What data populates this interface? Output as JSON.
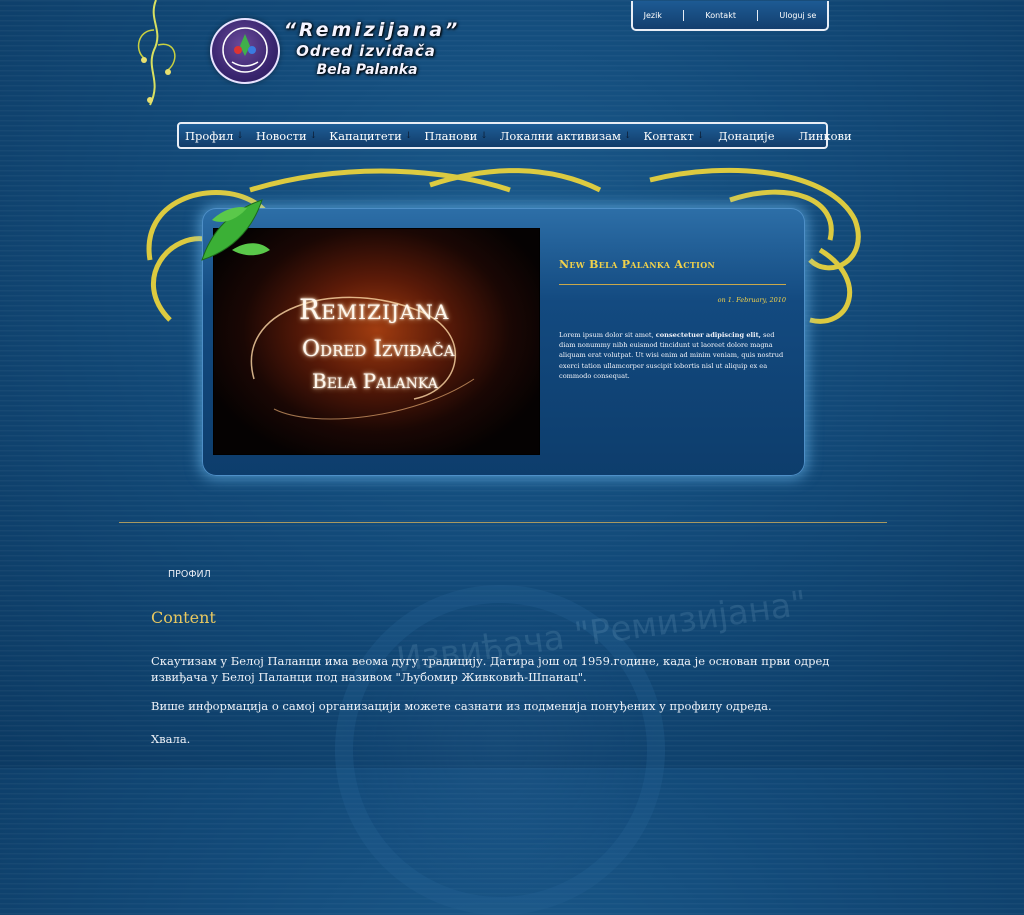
{
  "header": {
    "title_line1": "“Remizijana”",
    "title_line2": "Odred izviđača",
    "title_line3": "Bela Palanka"
  },
  "top_links": [
    "Jezik",
    "Kontakt",
    "Uloguj se"
  ],
  "nav": {
    "items": [
      {
        "label": "Профил",
        "arrow": "↓"
      },
      {
        "label": "Новости",
        "arrow": "↓"
      },
      {
        "label": "Капацитети",
        "arrow": "↓"
      },
      {
        "label": "Планови",
        "arrow": "↓"
      },
      {
        "label": "Локални активизам",
        "arrow": "↓"
      },
      {
        "label": "Контакт",
        "arrow": "↓"
      },
      {
        "label": "Донације",
        "arrow": ""
      },
      {
        "label": "Линкови",
        "arrow": ""
      }
    ]
  },
  "feature": {
    "image_lines": [
      "Remizijana",
      "Odred Izviđača",
      "Bela Palanka"
    ],
    "title": "New Bela Palanka Action",
    "date": "on 1. February, 2010",
    "text_lead": "Lorem ipsum dolor sit amet, ",
    "text_bold": "consectetuer adipiscing elit,",
    "text_rest": " sed diam nonummy nibh euismod tincidunt ut laoreet dolore magna aliquam erat volutpat. Ut wisi enim ad minim veniam, quis nostrud exerci tation ullamcorper suscipit lobortis nisl ut aliquip ex ea commodo consequat."
  },
  "content": {
    "breadcrumb": "ПРОФИЛ",
    "heading": "Content",
    "paragraphs": [
      "Скаутизам у Белој Паланци има веома дугу традицију. Датира још од 1959.године, када је основан први одред извиђача у Белој Паланци под називом \"Љубомир Живковић-Шпанац\".",
      "Више информација о самој организацији можете сазнати из подменија понуђених у профилу одреда.",
      "Хвала."
    ],
    "seal_text": "Извиђача \"Ремизијана\""
  },
  "colors": {
    "background": "#124a79",
    "accent_gold": "#f2d24a",
    "heading_gold": "#e8c860"
  }
}
